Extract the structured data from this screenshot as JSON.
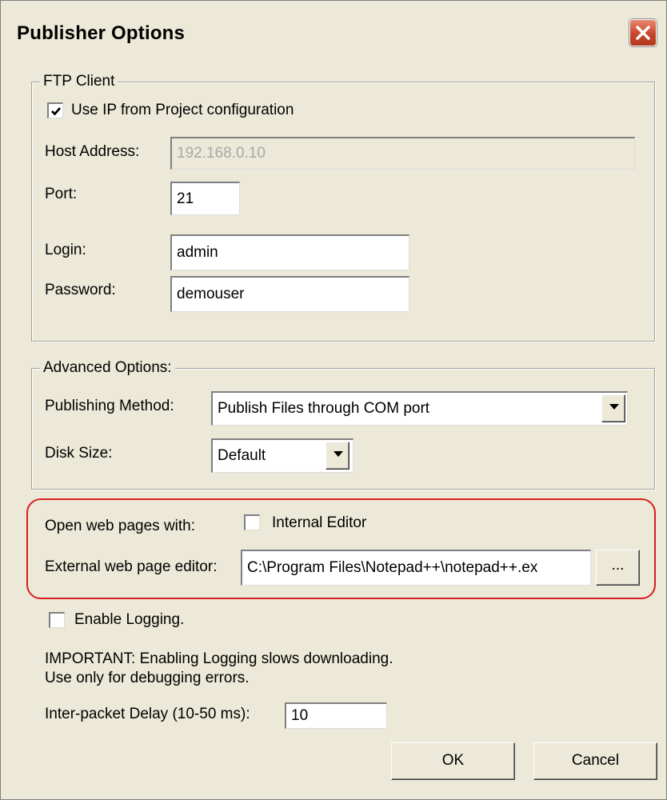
{
  "window": {
    "title": "Publisher Options"
  },
  "ftp": {
    "legend": "FTP Client",
    "use_ip_label": "Use IP from Project configuration",
    "use_ip_checked": true,
    "host_label": "Host Address:",
    "host_value": "192.168.0.10",
    "port_label": "Port:",
    "port_value": "21",
    "login_label": "Login:",
    "login_value": "admin",
    "password_label": "Password:",
    "password_value": "demouser"
  },
  "advanced": {
    "legend": "Advanced Options:",
    "method_label": "Publishing Method:",
    "method_value": "Publish Files through COM port",
    "disk_label": "Disk Size:",
    "disk_value": "Default"
  },
  "editor": {
    "open_with_label": "Open web pages with:",
    "internal_label": "Internal Editor",
    "internal_checked": false,
    "external_label": "External web page editor:",
    "external_value": "C:\\Program Files\\Notepad++\\notepad++.ex",
    "browse_label": "..."
  },
  "logging": {
    "enable_label": "Enable Logging.",
    "enable_checked": false,
    "warning_line1": "IMPORTANT: Enabling Logging slows downloading.",
    "warning_line2": "Use only for debugging errors.",
    "delay_label": "Inter-packet Delay (10-50 ms):",
    "delay_value": "10"
  },
  "buttons": {
    "ok": "OK",
    "cancel": "Cancel"
  },
  "icons": {
    "close": "close-icon",
    "checkmark": "checkmark-icon",
    "dropdown": "chevron-down-icon"
  },
  "colors": {
    "dialog_bg": "#ece9d8",
    "close_button": "#c8452a",
    "highlight_outline": "#d71f1f",
    "disabled_text": "#a8a8a8"
  }
}
